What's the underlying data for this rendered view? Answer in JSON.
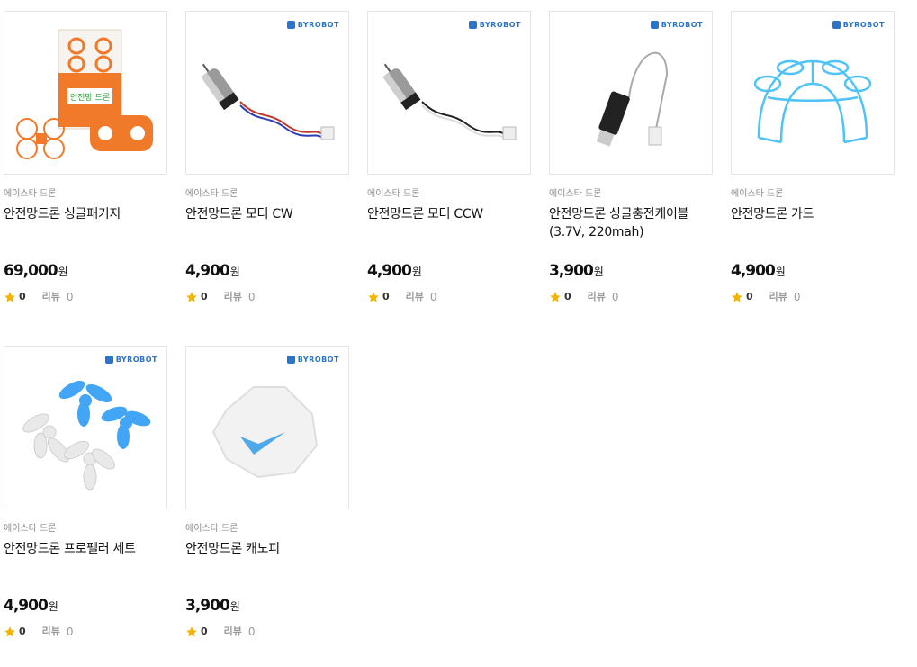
{
  "products": [
    {
      "brand": "에이스타 드론",
      "name": "안전망드론 싱글패키지",
      "price": "69,000",
      "currency": "원",
      "rating": "0",
      "review_label": "리뷰",
      "review_count": "0",
      "logo": ""
    },
    {
      "brand": "에이스타 드론",
      "name": "안전망드론 모터 CW",
      "price": "4,900",
      "currency": "원",
      "rating": "0",
      "review_label": "리뷰",
      "review_count": "0",
      "logo": "BYROBOT"
    },
    {
      "brand": "에이스타 드론",
      "name": "안전망드론 모터 CCW",
      "price": "4,900",
      "currency": "원",
      "rating": "0",
      "review_label": "리뷰",
      "review_count": "0",
      "logo": "BYROBOT"
    },
    {
      "brand": "에이스타 드론",
      "name": "안전망드론 싱글충전케이블 (3.7V, 220mah)",
      "price": "3,900",
      "currency": "원",
      "rating": "0",
      "review_label": "리뷰",
      "review_count": "0",
      "logo": "BYROBOT"
    },
    {
      "brand": "에이스타 드론",
      "name": "안전망드론 가드",
      "price": "4,900",
      "currency": "원",
      "rating": "0",
      "review_label": "리뷰",
      "review_count": "0",
      "logo": "BYROBOT"
    },
    {
      "brand": "에이스타 드론",
      "name": "안전망드론 프로펠러 세트",
      "price": "4,900",
      "currency": "원",
      "rating": "0",
      "review_label": "리뷰",
      "review_count": "0",
      "logo": "BYROBOT"
    },
    {
      "brand": "에이스타 드론",
      "name": "안전망드론 캐노피",
      "price": "3,900",
      "currency": "원",
      "rating": "0",
      "review_label": "리뷰",
      "review_count": "0",
      "logo": "BYROBOT"
    }
  ],
  "package_box_label": "안전망 드론",
  "colors": {
    "star": "#f5b301",
    "logo": "#2a74c9",
    "drone_orange": "#f07a2a",
    "guard_blue": "#4fc3f7"
  }
}
